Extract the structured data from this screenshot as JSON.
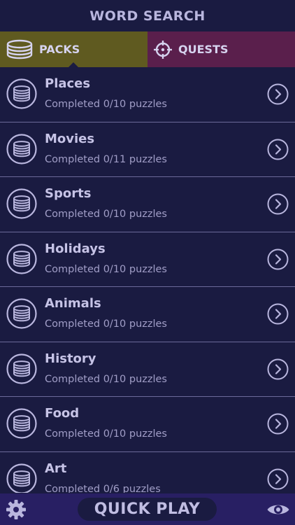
{
  "header": {
    "title": "WORD SEARCH"
  },
  "tabs": [
    {
      "label": "PACKS",
      "icon": "coin-stack-icon",
      "color": "#5f5a20"
    },
    {
      "label": "QUESTS",
      "icon": "crosshair-icon",
      "color": "#5a1f4c"
    }
  ],
  "packs": [
    {
      "title": "Places",
      "subtitle": "Completed 0/10 puzzles"
    },
    {
      "title": "Movies",
      "subtitle": "Completed 0/11 puzzles"
    },
    {
      "title": "Sports",
      "subtitle": "Completed 0/10 puzzles"
    },
    {
      "title": "Holidays",
      "subtitle": "Completed 0/10 puzzles"
    },
    {
      "title": "Animals",
      "subtitle": "Completed 0/10 puzzles"
    },
    {
      "title": "History",
      "subtitle": "Completed 0/10 puzzles"
    },
    {
      "title": "Food",
      "subtitle": "Completed 0/10 puzzles"
    },
    {
      "title": "Art",
      "subtitle": "Completed 0/6 puzzles"
    }
  ],
  "footer": {
    "quick_play_label": "QUICK PLAY",
    "settings_icon": "gear-icon",
    "view_icon": "eye-icon"
  },
  "colors": {
    "background": "#1a1b41",
    "footer": "#281f63",
    "icon_stroke": "#b9b6de"
  }
}
